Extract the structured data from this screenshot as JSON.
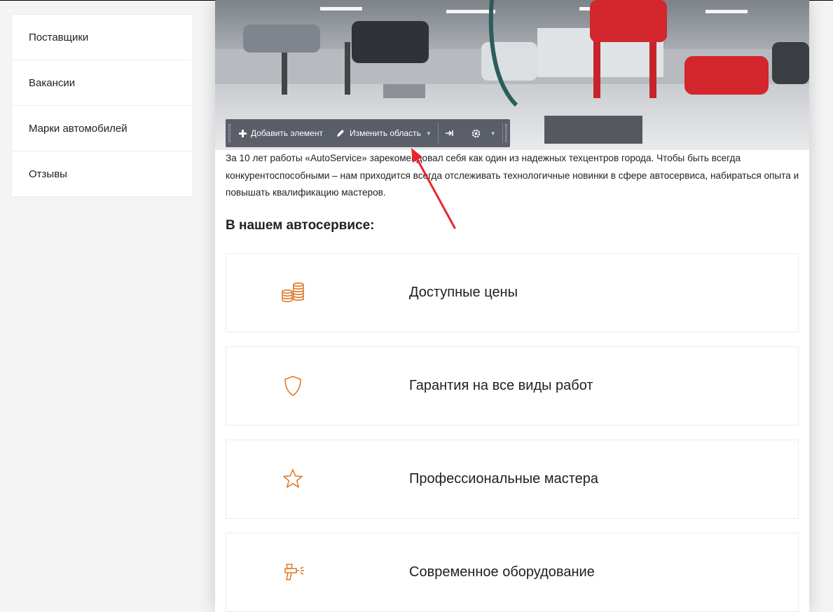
{
  "sidebar": {
    "items": [
      {
        "label": "Поставщики"
      },
      {
        "label": "Вакансии"
      },
      {
        "label": "Марки автомобилей"
      },
      {
        "label": "Отзывы"
      }
    ]
  },
  "toolbar": {
    "add_element": "Добавить элемент",
    "edit_area": "Изменить область",
    "icons": [
      "plus-icon",
      "pencil-icon",
      "chevron-down-icon",
      "collapse-icon",
      "gear-icon"
    ]
  },
  "content": {
    "intro": "За 10 лет работы «AutoService» зарекомендовал себя как один из надежных техцентров города. Чтобы быть всегда конкурентоспособными – нам приходится всегда отслеживать технологичные новинки в сфере автосервиса, набираться опыта и повышать квалификацию мастеров.",
    "section_title": "В нашем автосервисе:",
    "features": [
      {
        "label": "Доступные цены",
        "icon": "coins-icon"
      },
      {
        "label": "Гарантия на все виды работ",
        "icon": "shield-icon"
      },
      {
        "label": "Профессиональные мастера",
        "icon": "star-icon"
      },
      {
        "label": "Современное оборудование",
        "icon": "spray-gun-icon"
      }
    ]
  },
  "colors": {
    "accent_icon": "#e07a2a",
    "annotation_arrow": "#e8262b",
    "toolbar_bg": "#50545e"
  }
}
